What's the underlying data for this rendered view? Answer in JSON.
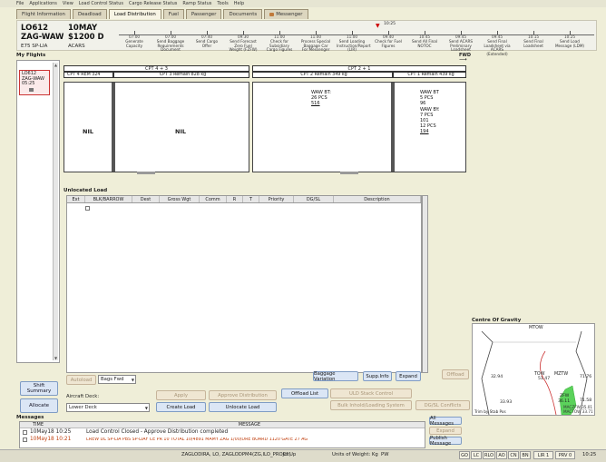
{
  "menu": [
    "File",
    "Applications",
    "View",
    "Load Control Status",
    "Cargo Release Status",
    "Ramp Status",
    "Tools",
    "Help"
  ],
  "tabs": [
    {
      "label": "Flight Information"
    },
    {
      "label": "Deadload"
    },
    {
      "label": "Load Distribution"
    },
    {
      "label": "Fuel"
    },
    {
      "label": "Passenger"
    },
    {
      "label": "Documents"
    },
    {
      "label": "Messenger"
    }
  ],
  "flight": {
    "number": "LO612",
    "route": "ZAG-WAW",
    "aircraft": "E75 SP-LIA",
    "date": "10MAY",
    "std": "$1200 D",
    "status": "ACARS",
    "now_time": "10:25"
  },
  "timeline": [
    {
      "time": "07:00",
      "label": "Generate Capacity"
    },
    {
      "time": "07:00",
      "label": "Send Baggage Requirements Document"
    },
    {
      "time": "07:40",
      "label": "Send Cargo Offer"
    },
    {
      "time": "09:30",
      "label": "Send Forecast Zero Fuel Weight (FZFW)"
    },
    {
      "time": "11:00",
      "label": "Check for Subsidiary Cargo Figures"
    },
    {
      "time": "11:00",
      "label": "Process Special Baggage Car For Messenger"
    },
    {
      "time": "11:00",
      "label": "Send Loading Instruction/Report (LIR)"
    },
    {
      "time": "09:40",
      "label": "Check for Fuel Figures"
    },
    {
      "time": "10:45",
      "label": "Send All Final NOTOC"
    },
    {
      "time": "09:45",
      "label": "Send ACARS Preliminary Loadsheet"
    },
    {
      "time": "09:45",
      "label": "Send Final Loadsheet via ACARS (Extended)"
    },
    {
      "time": "10:15",
      "label": "Send Final Loadsheet"
    },
    {
      "time": "10:25",
      "label": "Send Load Message (LDM)"
    }
  ],
  "my_flights": {
    "title": "My Flights",
    "card": {
      "number": "LO612",
      "route": "ZAG-WAW",
      "time": "05:25"
    }
  },
  "left_buttons": [
    {
      "label": "Shift Summary"
    },
    {
      "label": "Allocate"
    }
  ],
  "holds": {
    "fwd_label": "FWD",
    "aft_cpt_title": "CPT 4 + 3",
    "fwd_cpt_title": "CPT 2 + 1",
    "cpt4": "CPT 4 REM 324",
    "cpt3": "CPT 3 Remain 828 kg",
    "cpt2": "CPT 2 Remain 349 kg",
    "cpt1": "CPT 1 Remain 439 kg",
    "nil1": "NIL",
    "nil2": "NIL",
    "cpt2_text": [
      "WAW BT:",
      "26 PCS",
      "516"
    ],
    "cpt1_text": [
      "WAW BT",
      "5 PCS",
      "96",
      "WAW BY:",
      "7 PCS",
      "101",
      "12 PCS",
      "194"
    ]
  },
  "unlocated": {
    "title": "Unlocated Load",
    "columns": [
      "Ext",
      "BLK/BARROW",
      "Dest",
      "Gross Wgt",
      "Comm",
      "R",
      "T",
      "Priority",
      "DG/SL",
      "Description"
    ]
  },
  "controls": {
    "autoload": "Autoload",
    "bags_fwd": "Bags Fwd",
    "aircraft_deck_label": "Aircraft Deck:",
    "aircraft_deck_value": "Lower Deck",
    "apply": "Apply",
    "approve_distribution": "Approve Distribution",
    "create_load": "Create Load",
    "unlocate_load": "Unlocate Load",
    "offload_list": "Offload List",
    "uld_stack_control": "ULD Stack Control",
    "bulk_inhold": "Bulk Inhold/Loading System",
    "dg_sl_conflicts": "DG/SL Conflicts",
    "baggage_variation": "Baggage Variation",
    "supp_info": "Supp.Info",
    "expand": "Expand",
    "offload": "Offload"
  },
  "cog": {
    "title": "Centre Of Gravity",
    "mtow": "MTOW",
    "tow": "TOW",
    "mztw": "MZTW",
    "zfw": "ZFW",
    "left_a": "32.94",
    "left_b": "33.93",
    "tow_val": "51.47",
    "mztw_val": "71.76",
    "zfw_val": "36.11",
    "right_b": "71.58",
    "foot_left": "Trim by Stab Pos",
    "foot_right": "MACZFW 35.01\nMACTOW 33.71"
  },
  "messages": {
    "title": "Messages",
    "columns": [
      "TIME",
      "MESSAGE"
    ],
    "rows": [
      {
        "time": "10May18 10:25",
        "text": "Load Control Closed - Approve Distribution completed",
        "color": "#222222"
      },
      {
        "time": "10May18 10:21",
        "text": "CREW DL SP-LIA PBS  SP-LIAF  CE PR 10 TOTAL 10/4891  MAMY  ZAG 1/00/DRE  BOARD 1120 GATE 27  AG",
        "color": "#c04010"
      }
    ],
    "buttons": [
      "All Messages",
      "Expand",
      "Publish Message"
    ]
  },
  "status_bar": {
    "path": "ZAGLODIRA, LO, ZAGLODPM4(ZG,ILO_PROJet)",
    "ci": "CI Up",
    "units": "Units of Weight: Kg",
    "pw": "PW",
    "indicators": [
      "GO",
      "LC",
      "RLO",
      "AO",
      "CN",
      "BN",
      "LIR 1",
      "PRV 0"
    ],
    "clock": "10:25"
  }
}
